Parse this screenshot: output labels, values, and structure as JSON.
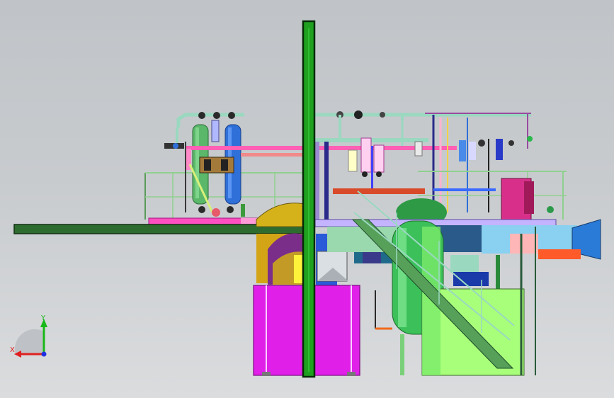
{
  "viewport": {
    "background": "#c8cbce",
    "palette": {
      "green_column": "#1fa11f",
      "platform": "#2e6b2e",
      "magenta_skid": "#e020e8",
      "pipe_blue": "#2f6fd8",
      "pipe_pink": "#ff5fb4",
      "vessel_green": "#3cc05a",
      "ladder_gray": "#4a7a5a"
    }
  },
  "orientation_triad": {
    "x_label": "X",
    "y_label": "Y",
    "x_color": "#e02020",
    "y_color": "#18b818",
    "z_color": "#2030e0",
    "icon": "axis-triad-icon"
  }
}
